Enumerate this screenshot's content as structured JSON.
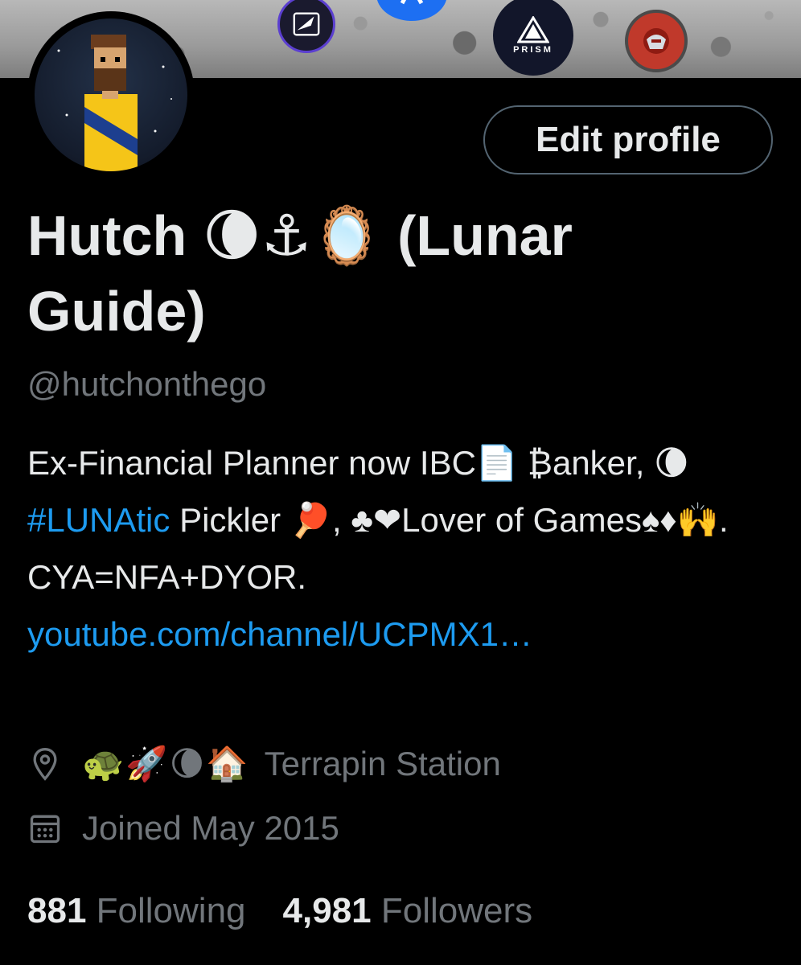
{
  "banner": {
    "logos": [
      "feather-logo",
      "blue-logo",
      "prism-logo",
      "red-mask-logo"
    ],
    "prism_label": "PRISM"
  },
  "profile": {
    "display_name": "Hutch 🌘⚓🪞 (Lunar Guide)",
    "handle": "@hutchonthego",
    "edit_button": "Edit profile",
    "bio": {
      "part1": "Ex-Financial Planner now IBC📄 ₿anker, 🌘",
      "hashtag": "#LUNAtic",
      "part2": " Pickler 🏓, ♣❤Lover of Games♠♦🙌. CYA=NFA+DYOR. ",
      "link": "youtube.com/channel/UCPMX1…"
    },
    "location": {
      "emoji": "🐢🚀🌘🏠",
      "text": "Terrapin Station"
    },
    "joined": "Joined May 2015",
    "following_count": "881",
    "following_label": "Following",
    "followers_count": "4,981",
    "followers_label": "Followers"
  },
  "colors": {
    "background": "#000000",
    "text": "#e7e9ea",
    "muted": "#71767b",
    "link": "#1d9bf0"
  }
}
